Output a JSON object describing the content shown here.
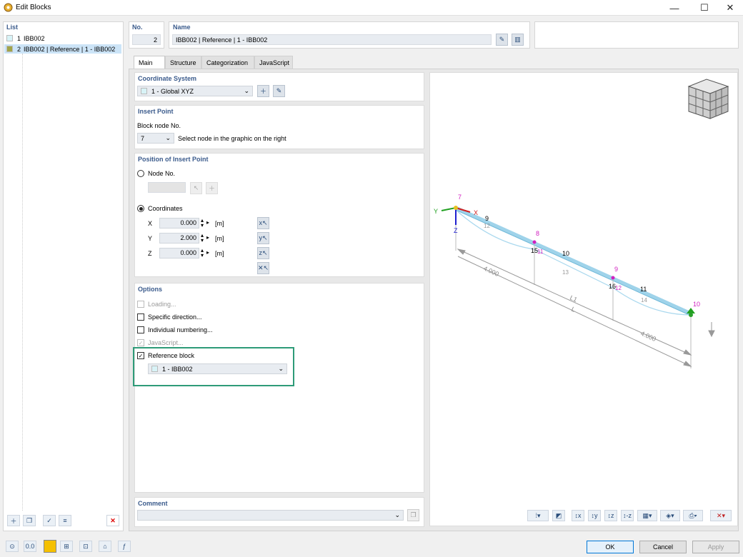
{
  "window": {
    "title": "Edit Blocks",
    "minimize": "—",
    "maximize": "☐",
    "close": "✕"
  },
  "list": {
    "header": "List",
    "items": [
      {
        "num": "1",
        "label": "IBB002",
        "color": "#d8f3f7"
      },
      {
        "num": "2",
        "label": "IBB002 | Reference | 1 - IBB002",
        "color": "#a0a44a",
        "selected": true
      }
    ]
  },
  "no": {
    "label": "No.",
    "value": "2"
  },
  "name": {
    "label": "Name",
    "value": "IBB002 | Reference | 1 - IBB002"
  },
  "tabs": [
    "Main",
    "Structure",
    "Categorization",
    "JavaScript"
  ],
  "coord": {
    "header": "Coordinate System",
    "value": "1 - Global XYZ"
  },
  "insert": {
    "header": "Insert Point",
    "block_node_label": "Block node No.",
    "block_node_value": "7",
    "hint": "Select node in the graphic on the right"
  },
  "position": {
    "header": "Position of Insert Point",
    "node_label": "Node No.",
    "coords_label": "Coordinates",
    "x": {
      "label": "X",
      "value": "0.000",
      "unit": "[m]"
    },
    "y": {
      "label": "Y",
      "value": "2.000",
      "unit": "[m]"
    },
    "z": {
      "label": "Z",
      "value": "0.000",
      "unit": "[m]"
    }
  },
  "options": {
    "header": "Options",
    "loading": "Loading...",
    "specific": "Specific direction...",
    "individual": "Individual numbering...",
    "javascript": "JavaScript...",
    "reference": "Reference block",
    "reference_value": "1 - IBB002"
  },
  "comment": {
    "header": "Comment",
    "value": ""
  },
  "graphic": {
    "nodes": [
      "7",
      "8",
      "9",
      "10"
    ],
    "node_labels_black": [
      "9",
      "10",
      "11",
      "15",
      "16"
    ],
    "line_labels": [
      "12",
      "13",
      "14"
    ],
    "sub_labels": [
      "11",
      "12"
    ],
    "dims": [
      "4.000",
      "4.000",
      "L1",
      "L"
    ],
    "axes": {
      "x": "X",
      "y": "Y",
      "z": "Z"
    }
  },
  "buttons": {
    "ok": "OK",
    "cancel": "Cancel",
    "apply": "Apply"
  },
  "colors": {
    "accent": "#3b5b8c",
    "highlight": "#2e9b78",
    "member": "#9fd3ea",
    "node": "#d020c0"
  }
}
